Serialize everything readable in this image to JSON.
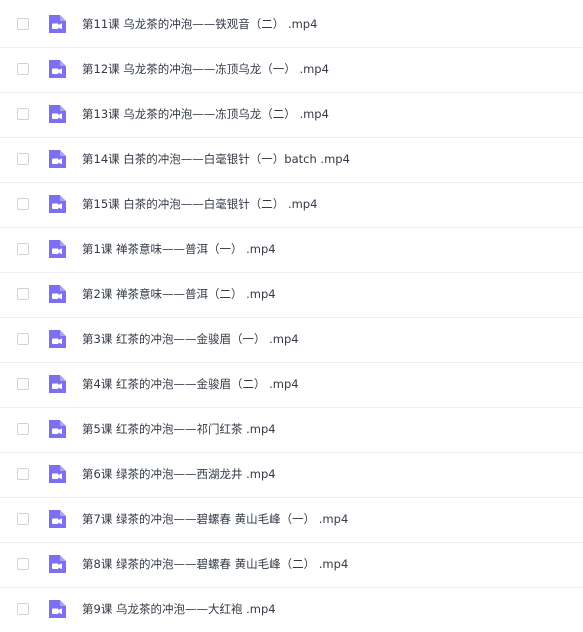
{
  "colors": {
    "icon": "#7c6ff0",
    "text": "#333a45",
    "divider": "#eef0f4"
  },
  "files": [
    {
      "name": "第11课 乌龙茶的冲泡——铁观音（二） .mp4",
      "icon": "video-file-icon",
      "checked": false
    },
    {
      "name": "第12课 乌龙茶的冲泡——冻顶乌龙（一） .mp4",
      "icon": "video-file-icon",
      "checked": false
    },
    {
      "name": "第13课 乌龙茶的冲泡——冻顶乌龙（二） .mp4",
      "icon": "video-file-icon",
      "checked": false
    },
    {
      "name": "第14课 白茶的冲泡——白毫银针（一）batch .mp4",
      "icon": "video-file-icon",
      "checked": false
    },
    {
      "name": "第15课 白茶的冲泡——白毫银针（二） .mp4",
      "icon": "video-file-icon",
      "checked": false
    },
    {
      "name": "第1课 禅茶意味——普洱（一） .mp4",
      "icon": "video-file-icon",
      "checked": false
    },
    {
      "name": "第2课 禅茶意味——普洱（二） .mp4",
      "icon": "video-file-icon",
      "checked": false
    },
    {
      "name": "第3课 红茶的冲泡——金骏眉（一） .mp4",
      "icon": "video-file-icon",
      "checked": false
    },
    {
      "name": "第4课 红茶的冲泡——金骏眉（二） .mp4",
      "icon": "video-file-icon",
      "checked": false
    },
    {
      "name": "第5课 红茶的冲泡——祁门红茶 .mp4",
      "icon": "video-file-icon",
      "checked": false
    },
    {
      "name": "第6课 绿茶的冲泡——西湖龙井 .mp4",
      "icon": "video-file-icon",
      "checked": false
    },
    {
      "name": "第7课 绿茶的冲泡——碧螺春 黄山毛峰（一） .mp4",
      "icon": "video-file-icon",
      "checked": false
    },
    {
      "name": "第8课 绿茶的冲泡——碧螺春 黄山毛峰（二） .mp4",
      "icon": "video-file-icon",
      "checked": false
    },
    {
      "name": "第9课 乌龙茶的冲泡——大红袍 .mp4",
      "icon": "video-file-icon",
      "checked": false
    }
  ]
}
